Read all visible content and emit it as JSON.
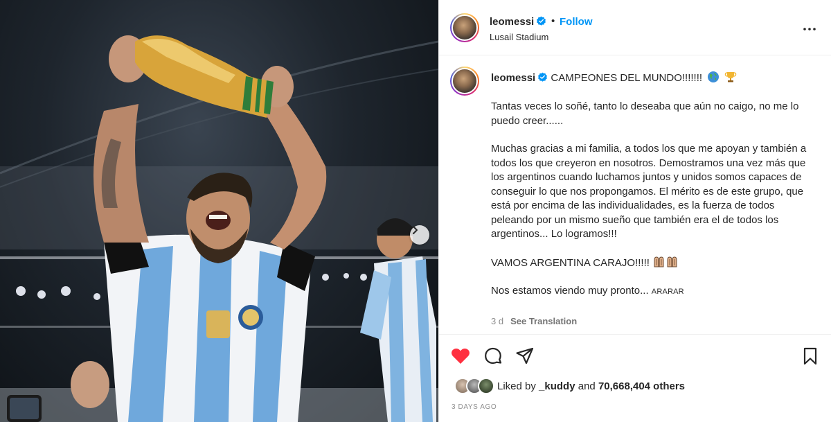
{
  "post": {
    "username": "leomessi",
    "verified": true,
    "follow_label": "Follow",
    "separator": "•",
    "location": "Lusail Stadium"
  },
  "caption": {
    "username": "leomessi",
    "headline": "CAMPEONES DEL MUNDO!!!!!!!",
    "headline_emojis": [
      "globe-emoji",
      "trophy-emoji"
    ],
    "paragraphs": [
      "Tantas veces lo soñé, tanto lo deseaba que aún no caigo, no me lo puedo creer......",
      "Muchas gracias a mi familia, a todos los que me apoyan y también a todos los que creyeron en nosotros. Demostramos una vez más que los argentinos cuando luchamos juntos y unidos somos capaces de conseguir lo que nos propongamos. El mérito es de este grupo, que está por encima de las individualidades, es la fuerza de todos peleando por un mismo sueño que también era el de todos los argentinos... Lo logramos!!!",
      "VAMOS ARGENTINA CARAJO!!!!!"
    ],
    "closing": "Nos estamos viendo muy pronto...",
    "closing_small": "ARARAR",
    "age": "3 d",
    "translate_label": "See Translation"
  },
  "likes": {
    "prefix": "Liked by",
    "liked_user": "_kuddy",
    "conjunction": "and",
    "count_label": "70,668,404 others"
  },
  "timestamp": "3 DAYS AGO",
  "icons": {
    "like": "heart-icon-filled",
    "comment": "comment-icon",
    "share": "share-icon",
    "save": "bookmark-icon",
    "more": "more-options-icon",
    "next": "chevron-right-icon"
  },
  "colors": {
    "accent": "#0095f6",
    "like": "#ff3040",
    "text": "#262626",
    "muted": "#8e8e8e",
    "verified": "#0095f6"
  }
}
